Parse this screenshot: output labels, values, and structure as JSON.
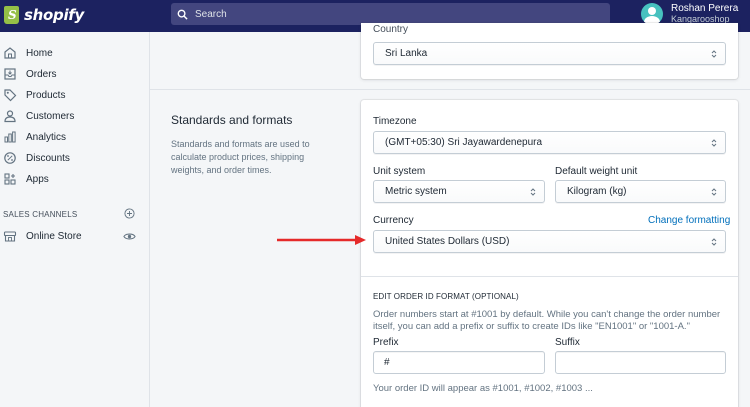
{
  "brand": {
    "logo_text": "shopify"
  },
  "search": {
    "placeholder": "Search"
  },
  "user": {
    "name": "Roshan Perera",
    "store": "Kangarooshop"
  },
  "sidebar": {
    "items": [
      {
        "label": "Home",
        "icon": "home-icon"
      },
      {
        "label": "Orders",
        "icon": "orders-icon"
      },
      {
        "label": "Products",
        "icon": "tag-icon"
      },
      {
        "label": "Customers",
        "icon": "customers-icon"
      },
      {
        "label": "Analytics",
        "icon": "bar-chart-icon"
      },
      {
        "label": "Discounts",
        "icon": "discount-icon"
      },
      {
        "label": "Apps",
        "icon": "apps-icon"
      }
    ],
    "sales_channels_title": "SALES CHANNELS",
    "channels": [
      {
        "label": "Online Store",
        "icon": "store-icon"
      }
    ]
  },
  "address": {
    "country_label": "Country",
    "country_value": "Sri Lanka"
  },
  "standards": {
    "title": "Standards and formats",
    "description": "Standards and formats are used to calculate product prices, shipping weights, and order times.",
    "timezone_label": "Timezone",
    "timezone_value": "(GMT+05:30) Sri Jayawardenepura",
    "unit_system_label": "Unit system",
    "unit_system_value": "Metric system",
    "weight_unit_label": "Default weight unit",
    "weight_unit_value": "Kilogram (kg)",
    "currency_label": "Currency",
    "change_formatting": "Change formatting",
    "currency_value": "United States Dollars (USD)"
  },
  "order_id": {
    "heading": "EDIT ORDER ID FORMAT (OPTIONAL)",
    "help": "Order numbers start at #1001 by default. While you can't change the order number itself, you can add a prefix or suffix to create IDs like \"EN1001\" or \"1001-A.\"",
    "prefix_label": "Prefix",
    "prefix_value": "#",
    "suffix_label": "Suffix",
    "suffix_value": "",
    "hint": "Your order ID will appear as #1001, #1002, #1003 ..."
  },
  "colors": {
    "topbar": "#1c2260",
    "link": "#006fbb",
    "annotation_arrow": "#e52a2a"
  }
}
